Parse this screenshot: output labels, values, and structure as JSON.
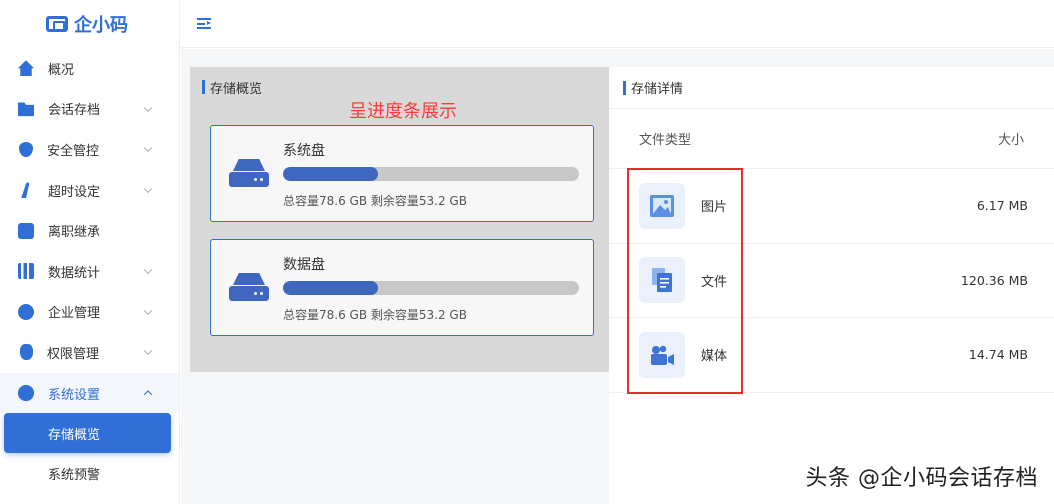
{
  "brand": {
    "name": "企小码"
  },
  "sidebar": {
    "items": [
      {
        "label": "概况",
        "icon": "home-icon",
        "chevron": false
      },
      {
        "label": "会话存档",
        "icon": "folder-icon",
        "chevron": true
      },
      {
        "label": "安全管控",
        "icon": "shield-icon",
        "chevron": true
      },
      {
        "label": "超时设定",
        "icon": "timer-icon",
        "chevron": true
      },
      {
        "label": "离职继承",
        "icon": "user-transfer-icon",
        "chevron": false
      },
      {
        "label": "数据统计",
        "icon": "bar-chart-icon",
        "chevron": true
      },
      {
        "label": "企业管理",
        "icon": "enterprise-icon",
        "chevron": true
      },
      {
        "label": "权限管理",
        "icon": "lock-icon",
        "chevron": true
      },
      {
        "label": "系统设置",
        "icon": "gear-icon",
        "chevron": true,
        "open": true
      }
    ],
    "subitems": [
      {
        "label": "存储概览",
        "active": true
      },
      {
        "label": "系统预警",
        "active": false
      }
    ]
  },
  "overview": {
    "title": "存储概览",
    "annotation": "呈进度条展示",
    "disks": [
      {
        "name": "系统盘",
        "capacity_text": "总容量78.6 GB 剩余容量53.2 GB",
        "used_fraction": 0.32
      },
      {
        "name": "数据盘",
        "capacity_text": "总容量78.6 GB 剩余容量53.2 GB",
        "used_fraction": 0.32
      }
    ]
  },
  "details": {
    "title": "存储详情",
    "columns": {
      "type": "文件类型",
      "size": "大小"
    },
    "rows": [
      {
        "type": "图片",
        "size": "6.17 MB",
        "icon": "image-icon"
      },
      {
        "type": "文件",
        "size": "120.36 MB",
        "icon": "document-icon"
      },
      {
        "type": "媒体",
        "size": "14.74 MB",
        "icon": "video-camera-icon"
      }
    ]
  },
  "watermark": "头条 @企小码会话存档",
  "colors": {
    "primary": "#2f6fd6",
    "annotation": "#ff3b3b",
    "highlight": "#e53030"
  }
}
